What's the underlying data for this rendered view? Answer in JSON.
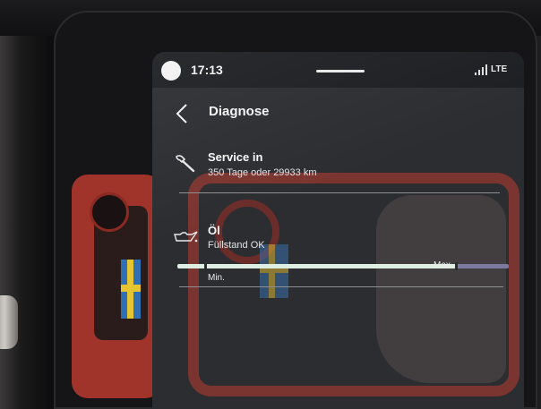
{
  "status_bar": {
    "time": "17:13",
    "network": "LTE"
  },
  "header": {
    "title": "Diagnose",
    "back_icon": "chevron-left-icon"
  },
  "items": [
    {
      "icon": "wrench-icon",
      "title": "Service in",
      "subtitle": "350 Tage oder 29933 km"
    },
    {
      "icon": "oil-can-icon",
      "title": "Öl",
      "subtitle": "Füllstand OK",
      "level": {
        "min_label": "Min.",
        "max_label": "Max.",
        "fill_fraction": 0.84
      }
    }
  ],
  "colors": {
    "screen_bg": "#2b2d31",
    "status_bg": "#1d1e21",
    "level_fill": "#dfeee2",
    "level_track": "#7a7aa0",
    "text": "#f4f4f4"
  }
}
